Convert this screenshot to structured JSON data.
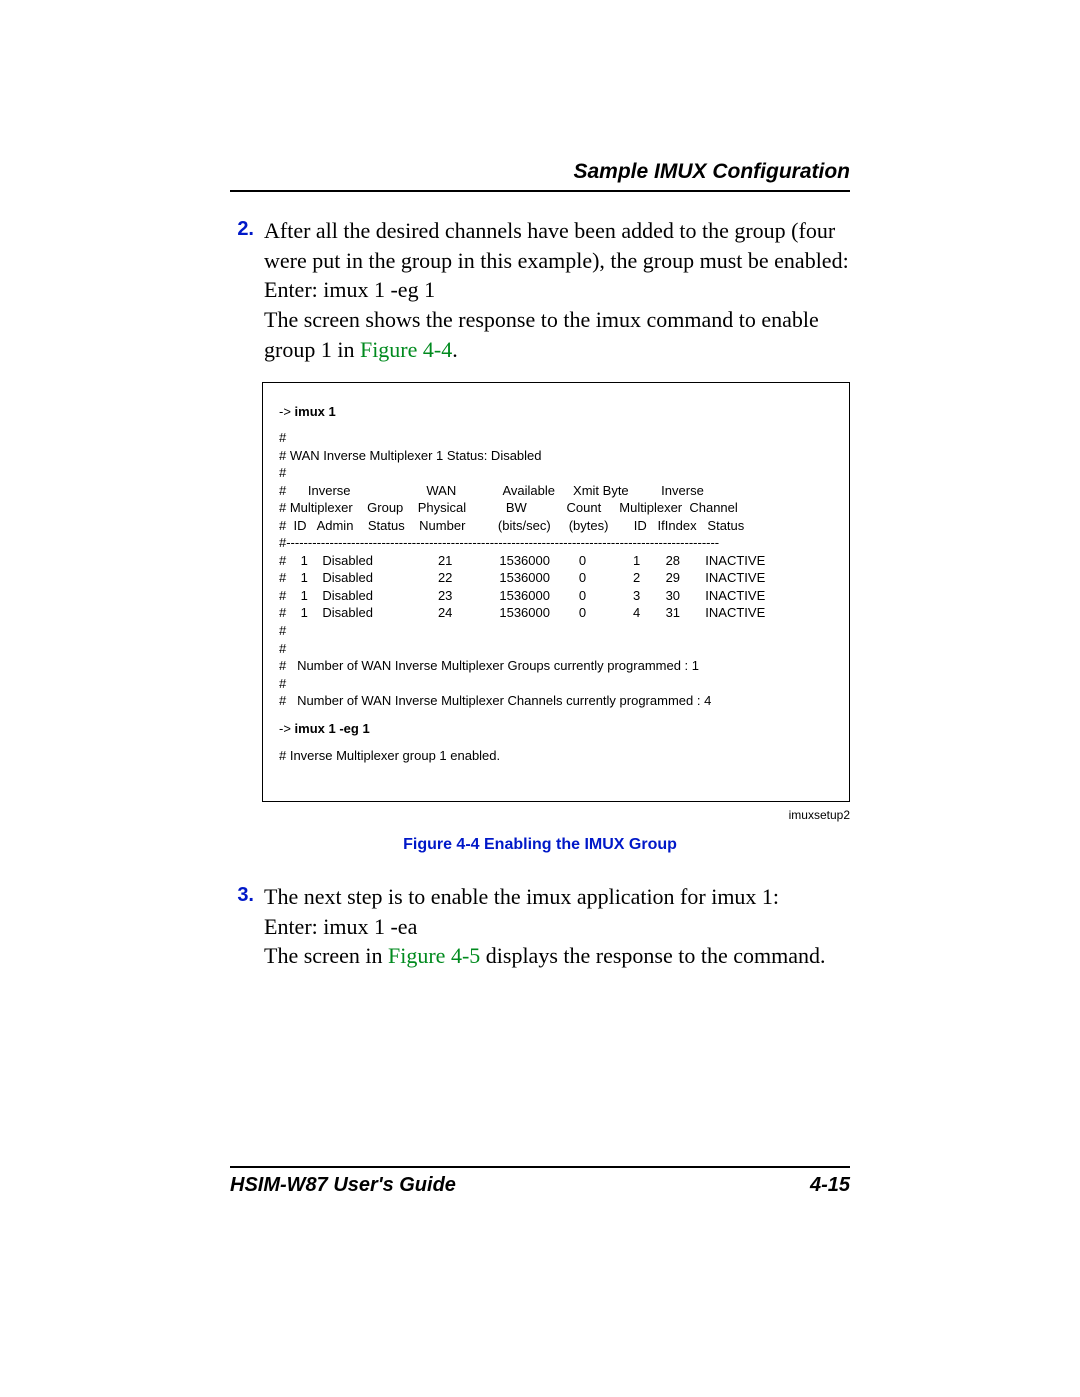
{
  "header": {
    "section_title": "Sample IMUX Configuration"
  },
  "step2": {
    "num": "2.",
    "para1": "After all the desired channels have been added to the group (four were put in the group in this example), the group must be enabled:",
    "cmd_line": "Enter: imux 1 -eg 1",
    "para2_pre": "The screen shows the response to the imux command to enable group 1 in ",
    "para2_ref": "Figure 4-4",
    "para2_post": "."
  },
  "code_box": {
    "prompt1_pre": "-> ",
    "prompt1_cmd": "imux 1",
    "status_block": "#\n# WAN Inverse Multiplexer 1 Status: Disabled\n#",
    "table_header": "#      Inverse                     WAN             Available     Xmit Byte         Inverse\n# Multiplexer    Group    Physical           BW           Count     Multiplexer  Channel\n#  ID   Admin    Status    Number         (bits/sec)     (bytes)       ID   IfIndex   Status\n#----------------------------------------------------------------------------------------------------",
    "rows": [
      "#    1    Disabled                  21             1536000        0             1       28       INACTIVE",
      "#    1    Disabled                  22             1536000        0             2       29       INACTIVE",
      "#    1    Disabled                  23             1536000        0             3       30       INACTIVE",
      "#    1    Disabled                  24             1536000        0             4       31       INACTIVE"
    ],
    "groups_line": "#\n#\n#   Number of WAN Inverse Multiplexer Groups currently programmed : 1\n#",
    "channels_line": "#   Number of WAN Inverse Multiplexer Channels currently programmed : 4",
    "prompt2_pre": "-> ",
    "prompt2_cmd": "imux 1 -eg 1",
    "result_line": "# Inverse Multiplexer group 1 enabled."
  },
  "code_caption_right": "imuxsetup2",
  "figure_caption": "Figure 4-4   Enabling the IMUX Group",
  "step3": {
    "num": "3.",
    "para1": "The next step is to enable the imux application for imux 1:",
    "cmd_line": "Enter: imux 1 -ea",
    "para2_pre": "The screen in ",
    "para2_ref": "Figure 4-5",
    "para2_post": " displays the response to the command."
  },
  "footer": {
    "left": "HSIM-W87 User's Guide",
    "right": "4-15"
  }
}
